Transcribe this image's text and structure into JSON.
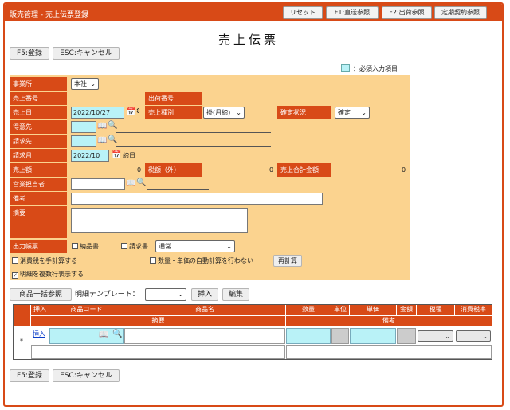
{
  "window": {
    "title": "販売管理 - 売上伝票登録"
  },
  "titlebar_buttons": {
    "reset": "リセット",
    "direct": "F1:直送参照",
    "shipment": "F2:出荷参照",
    "contract": "定期契約参照"
  },
  "page_title": "売上伝票",
  "actions": {
    "save": "F5:登録",
    "cancel": "ESC:キャンセル"
  },
  "legend": "：必須入力項目",
  "form": {
    "office_label": "事業所",
    "office_value": "本社",
    "sales_no_label": "売上番号",
    "shipping_no_label": "出荷番号",
    "sales_date_label": "売上日",
    "sales_date_value": "2022/10/27",
    "sales_type_label": "売上種別",
    "sales_type_value": "掛(月締)",
    "status_label": "確定状況",
    "status_value": "確定",
    "customer_label": "得意先",
    "billing_label": "請求先",
    "billing_month_label": "請求月",
    "billing_month_value": "2022/10",
    "closing_suffix": "締日",
    "sales_amount_label": "売上額",
    "sales_amount_value": "0",
    "tax_label": "税額（外）",
    "tax_value": "0",
    "total_label": "売上合計金額",
    "total_value": "0",
    "staff_label": "営業担当者",
    "remarks_label": "備考",
    "summary_label": "摘要",
    "output_label": "出力帳票",
    "delivery_note": "納品書",
    "invoice": "請求書",
    "output_select": "通常",
    "manual_tax": "消費税を手計算する",
    "no_auto_calc": "数量・単価の自動計算を行わない",
    "recalc": "再計算",
    "multi_line": "明細を複数行表示する"
  },
  "detail_toolbar": {
    "bulk_ref": "商品一括参照",
    "template_label": "明細テンプレート：",
    "insert": "挿入",
    "edit": "編集"
  },
  "grid": {
    "headers": {
      "insert": "挿入",
      "code": "商品コード",
      "name": "商品名",
      "qty": "数量",
      "unit": "単位",
      "price": "単価",
      "amount": "金額",
      "tax_type": "税種",
      "tax_rate": "消費税率",
      "summary": "摘要",
      "remarks": "備考"
    },
    "row_insert": "挿入",
    "row_marker": "*"
  }
}
